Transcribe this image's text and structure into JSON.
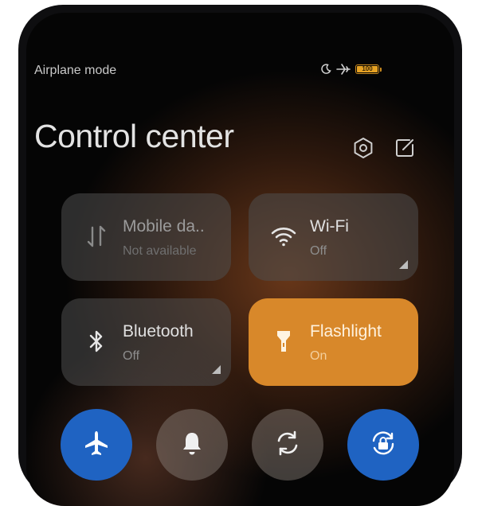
{
  "status_bar": {
    "label": "Airplane mode",
    "icons": [
      "moon-icon",
      "airplane-icon",
      "battery-icon"
    ],
    "battery_level": "100"
  },
  "header": {
    "title": "Control center",
    "settings_icon": "settings-hexagon-icon",
    "edit_icon": "edit-icon"
  },
  "tiles": [
    {
      "label": "Mobile da..",
      "status": "Not available",
      "icon": "mobile-data-icon",
      "active": false
    },
    {
      "label": "Wi-Fi",
      "status": "Off",
      "icon": "wifi-icon",
      "active": false
    },
    {
      "label": "Bluetooth",
      "status": "Off",
      "icon": "bluetooth-icon",
      "active": false
    },
    {
      "label": "Flashlight",
      "status": "On",
      "icon": "flashlight-icon",
      "active": true
    }
  ],
  "toggles": [
    {
      "name": "airplane",
      "icon": "airplane-icon",
      "active": true
    },
    {
      "name": "silent",
      "icon": "bell-icon",
      "active": false
    },
    {
      "name": "auto-rotate",
      "icon": "rotate-icon",
      "active": false
    },
    {
      "name": "rotation-lock",
      "icon": "rotation-lock-icon",
      "active": true
    }
  ],
  "colors": {
    "accent_orange": "#d8882a",
    "accent_blue": "#1f63c2",
    "battery": "#e6a224",
    "tile_bg": "#4e4e4e"
  }
}
